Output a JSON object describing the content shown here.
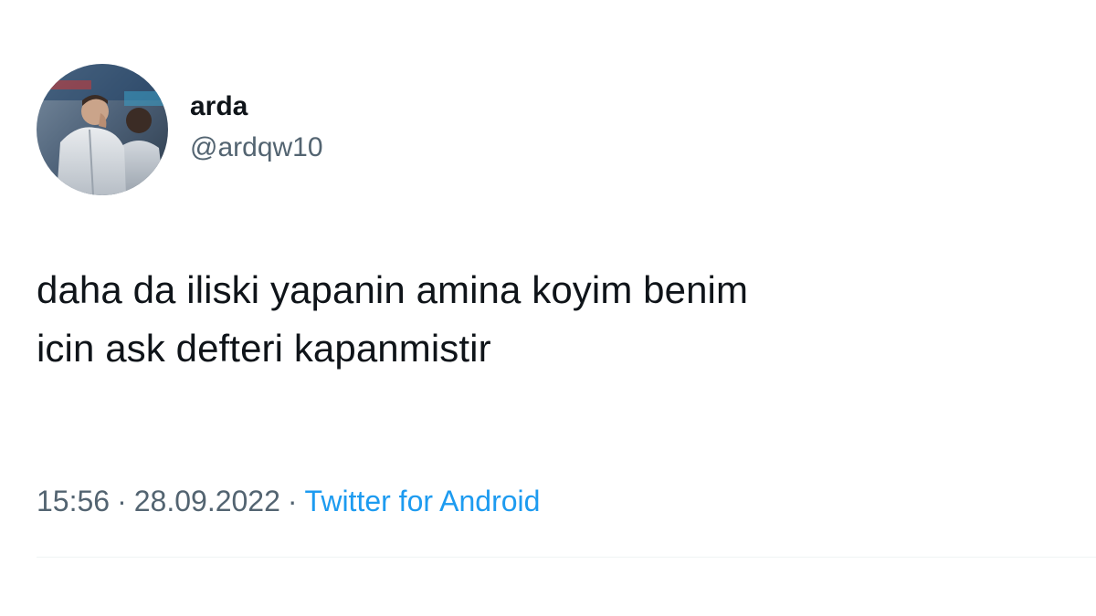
{
  "author": {
    "display_name": "arda",
    "handle": "@ardqw10",
    "avatar_icon": "profile-photo-avatar"
  },
  "tweet": {
    "text_line_1": "daha da iliski yapanin amina koyim benim",
    "text_line_2": "icin ask defteri kapanmistir"
  },
  "meta": {
    "time": "15:56",
    "separator": "·",
    "date": "28.09.2022",
    "client": "Twitter for Android"
  },
  "colors": {
    "text": "#0f1419",
    "secondary_text": "#536471",
    "link": "#1d9bf0",
    "divider": "#eff3f4",
    "background": "#ffffff"
  }
}
